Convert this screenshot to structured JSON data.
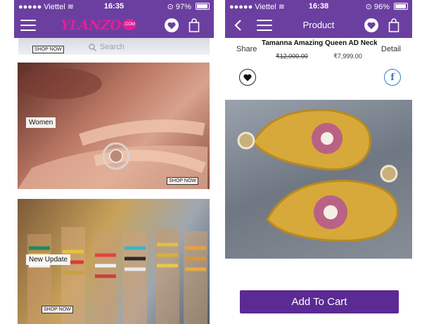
{
  "left_screen": {
    "status": {
      "carrier": "Viettel",
      "time": "16:35",
      "battery": "97%",
      "battery_level": 0.97
    },
    "brand": {
      "logo_text": "YLANZO",
      "logo_suffix": ".COM"
    },
    "search": {
      "placeholder": "Search",
      "strip_tag": "SHOP NOW"
    },
    "banners": [
      {
        "label": "Women",
        "tag": "SHOP NOW"
      },
      {
        "label": "New Update",
        "tag": "SHOP NOW"
      }
    ]
  },
  "right_screen": {
    "status": {
      "carrier": "Viettel",
      "time": "16:38",
      "battery": "96%",
      "battery_level": 0.96
    },
    "nav_title": "Product",
    "share_label": "Share",
    "detail_label": "Detail",
    "product": {
      "name": "Tamanna  Amazing Queen AD Neck...",
      "original_price": "₹12,000.00",
      "sale_price": "₹7,999.00"
    },
    "facebook_glyph": "f",
    "add_to_cart_label": "Add To Cart"
  },
  "colors": {
    "brand_purple": "#6b3fa0",
    "button_purple": "#5b2a92",
    "logo_pink": "#e0209a",
    "facebook_blue": "#3b78c4"
  }
}
